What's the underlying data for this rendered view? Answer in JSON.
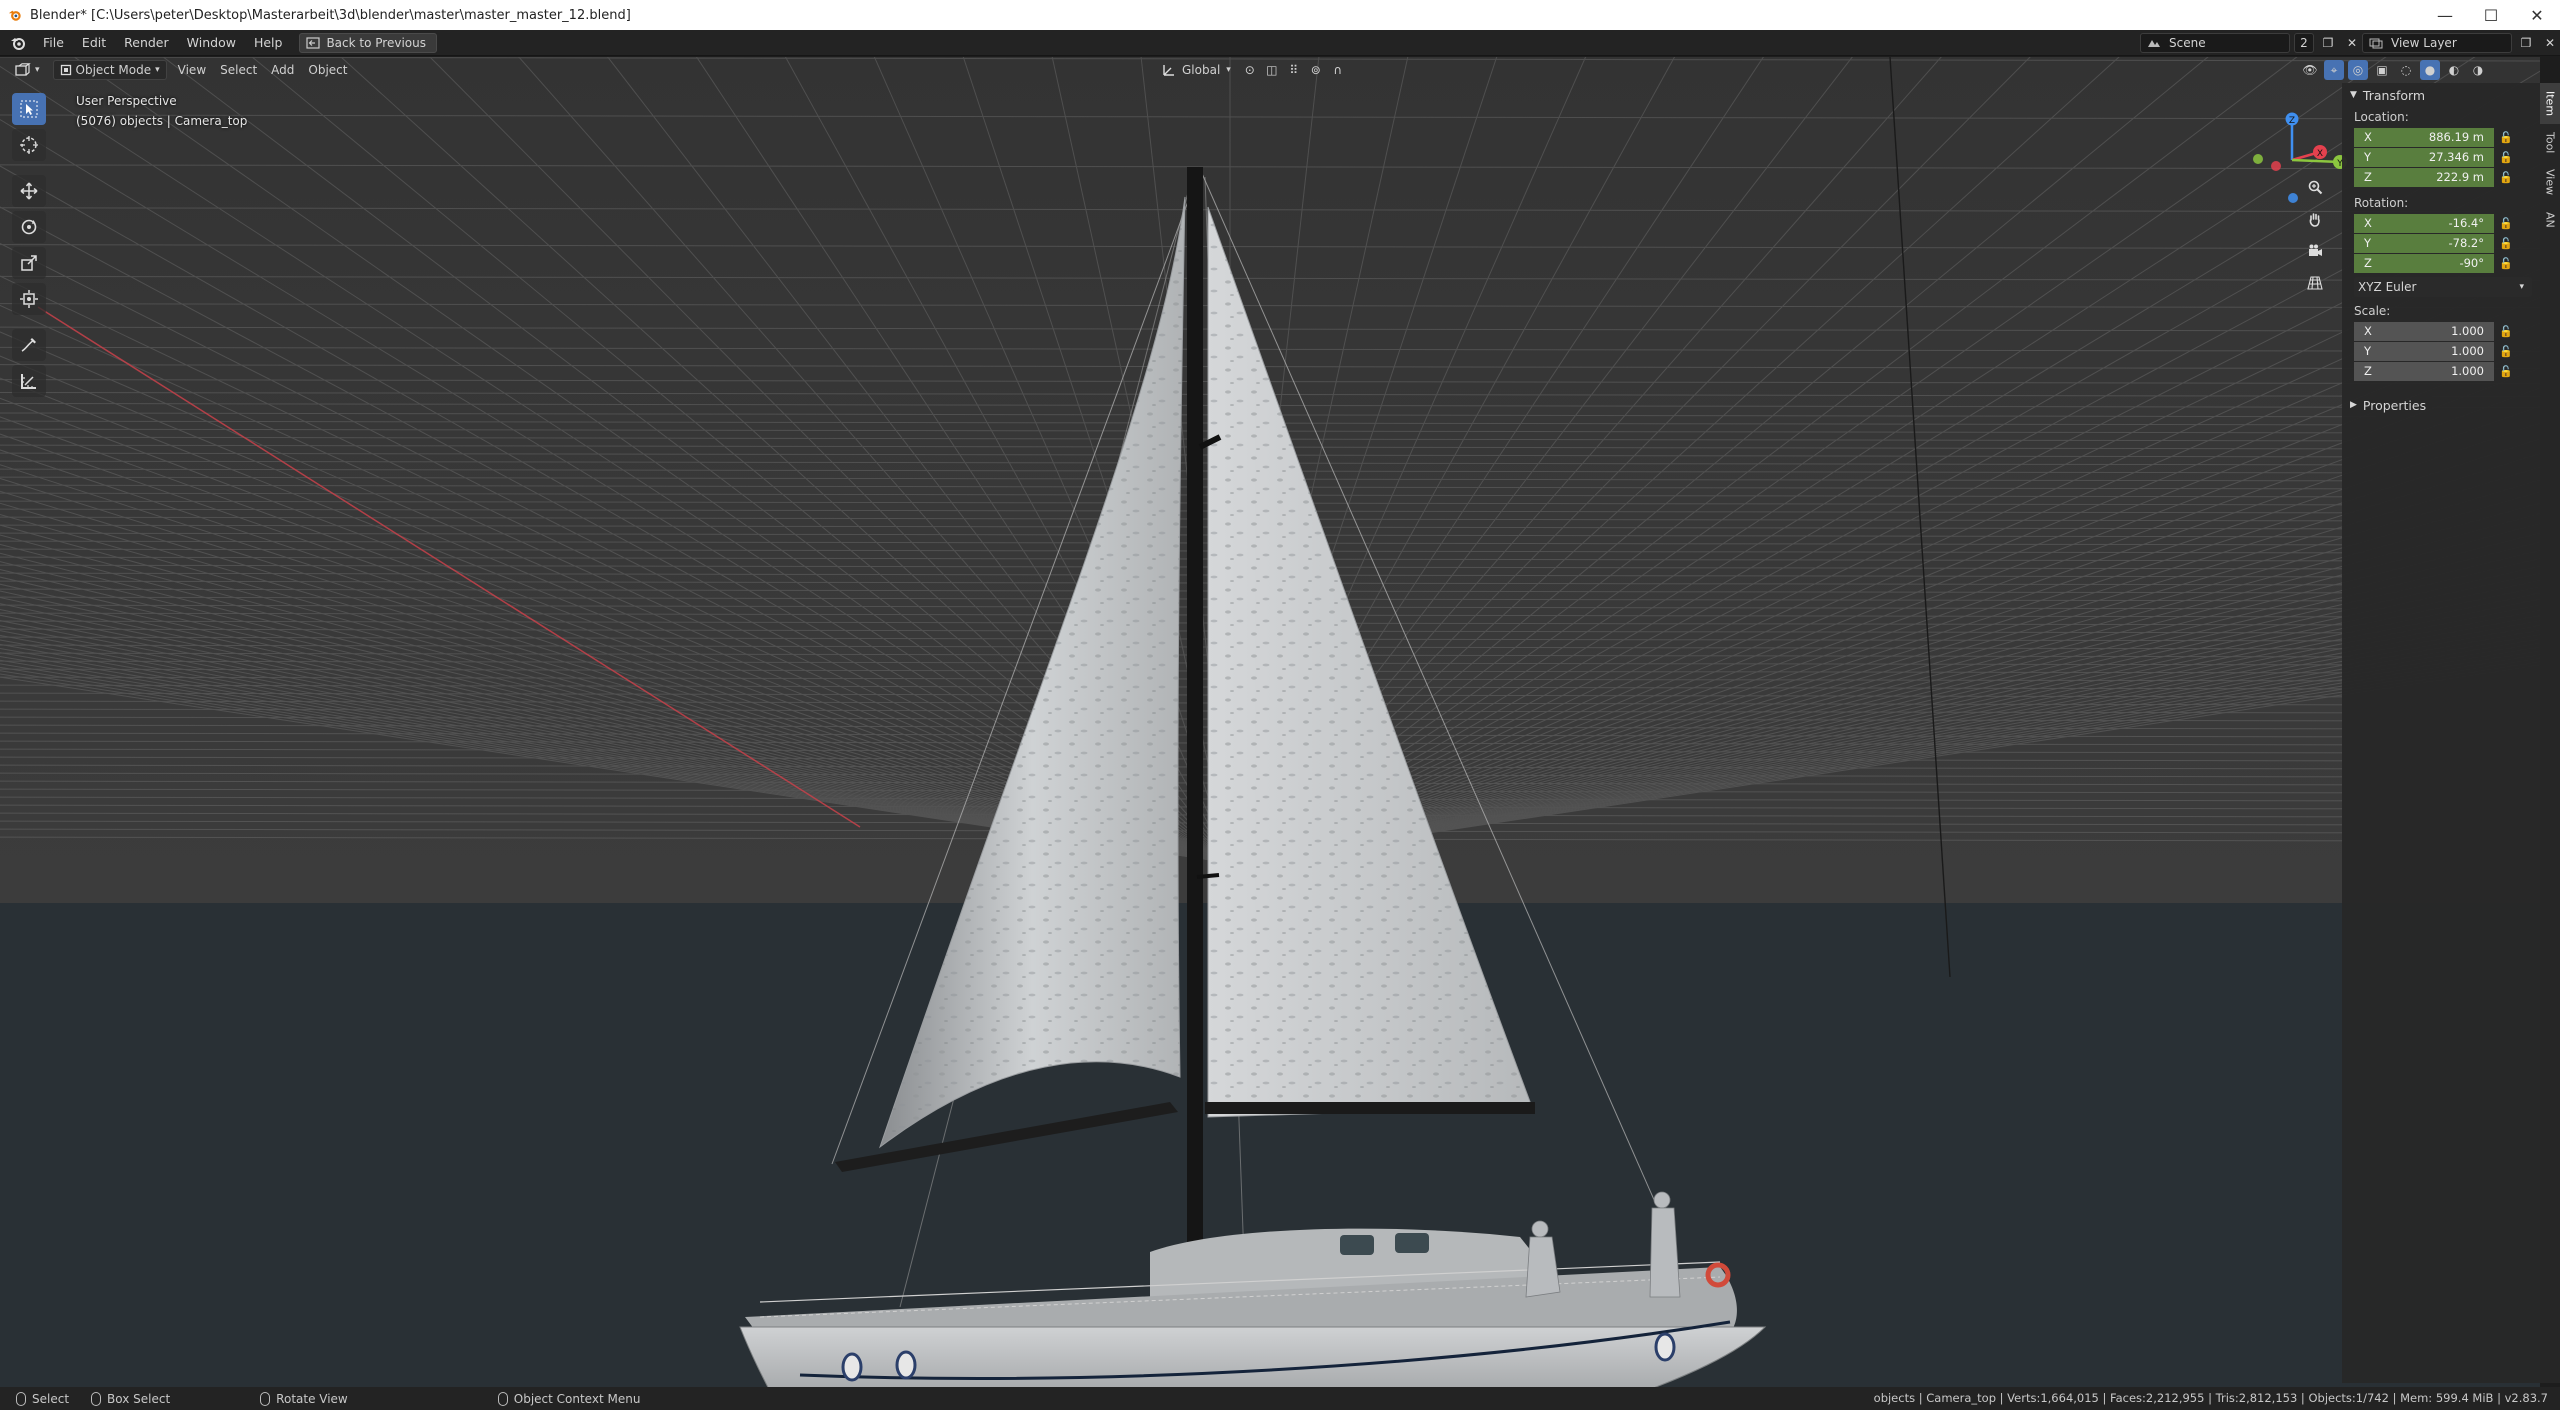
{
  "window": {
    "title": "Blender* [C:\\Users\\peter\\Desktop\\Masterarbeit\\3d\\blender\\master\\master_master_12.blend]",
    "controls": [
      "—",
      "☐",
      "✕"
    ]
  },
  "topbar": {
    "menus": [
      "File",
      "Edit",
      "Render",
      "Window",
      "Help"
    ],
    "back_button": "Back to Previous",
    "scene_name": "Scene",
    "scene_users": "2",
    "view_layer": "View Layer"
  },
  "viewport_header": {
    "mode": "Object Mode",
    "menus": [
      "View",
      "Select",
      "Add",
      "Object"
    ],
    "orientation": "Global"
  },
  "viewport": {
    "perspective_label": "User Perspective",
    "context_label": "(5076) objects | Camera_top",
    "colors": {
      "sky": "#363636",
      "sea": "#293035",
      "grid": "#6a6a6a",
      "x_axis": "#c8414a",
      "sail": "#c9cccf",
      "hull": "#c0c2c4"
    }
  },
  "gizmo": {
    "axes": [
      "X",
      "Y",
      "Z"
    ],
    "colors": {
      "x": "#e5414e",
      "y": "#8cc63f",
      "z": "#3f8ff0"
    }
  },
  "npanel": {
    "section": "Transform",
    "location_label": "Location:",
    "location": {
      "x": "886.19 m",
      "y": "27.346 m",
      "z": "222.9 m"
    },
    "rotation_label": "Rotation:",
    "rotation": {
      "x": "-16.4°",
      "y": "-78.2°",
      "z": "-90°"
    },
    "rotation_mode": "XYZ Euler",
    "scale_label": "Scale:",
    "scale": {
      "x": "1.000",
      "y": "1.000",
      "z": "1.000"
    },
    "properties": "Properties",
    "tabs": [
      "Item",
      "Tool",
      "View",
      "AN"
    ]
  },
  "statusbar": {
    "select": "Select",
    "box_select": "Box Select",
    "rotate_view": "Rotate View",
    "context_menu": "Object Context Menu",
    "stats": "objects | Camera_top | Verts:1,664,015 | Faces:2,212,955 | Tris:2,812,153 | Objects:1/742 | Mem: 599.4 MiB | v2.83.7"
  }
}
